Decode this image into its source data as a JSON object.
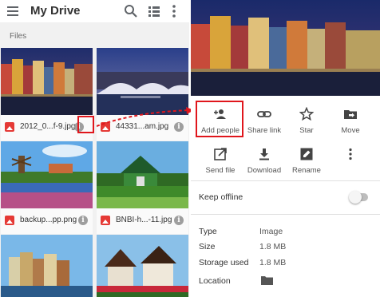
{
  "app": {
    "title": "My Drive"
  },
  "files_section": {
    "label": "Files",
    "items": [
      {
        "name": "2012_0...f-9.jpg",
        "type": "image"
      },
      {
        "name": "44331...am.jpg",
        "type": "image"
      },
      {
        "name": "backup...pp.png",
        "type": "image"
      },
      {
        "name": "BNBI-h...-11.jpg",
        "type": "image"
      },
      {
        "name": "",
        "type": "image"
      },
      {
        "name": "",
        "type": "image"
      }
    ]
  },
  "detail_panel": {
    "actions_row1": [
      {
        "label": "Add people",
        "icon": "person-add-icon"
      },
      {
        "label": "Share link",
        "icon": "link-icon"
      },
      {
        "label": "Star",
        "icon": "star-icon"
      },
      {
        "label": "Move",
        "icon": "move-folder-icon"
      }
    ],
    "actions_row2": [
      {
        "label": "Send file",
        "icon": "send-file-icon"
      },
      {
        "label": "Download",
        "icon": "download-icon"
      },
      {
        "label": "Rename",
        "icon": "rename-icon"
      },
      {
        "label": "",
        "icon": "more-vert-icon"
      }
    ],
    "keep_offline": {
      "label": "Keep offline",
      "enabled": false
    },
    "properties": [
      {
        "label": "Type",
        "value": "Image"
      },
      {
        "label": "Size",
        "value": "1.8 MB"
      },
      {
        "label": "Storage used",
        "value": "1.8 MB"
      },
      {
        "label": "Location",
        "value": ""
      }
    ]
  },
  "colors": {
    "highlight": "#e0161c",
    "icon_gray": "#5f6368",
    "file_type_red": "#e53935"
  }
}
